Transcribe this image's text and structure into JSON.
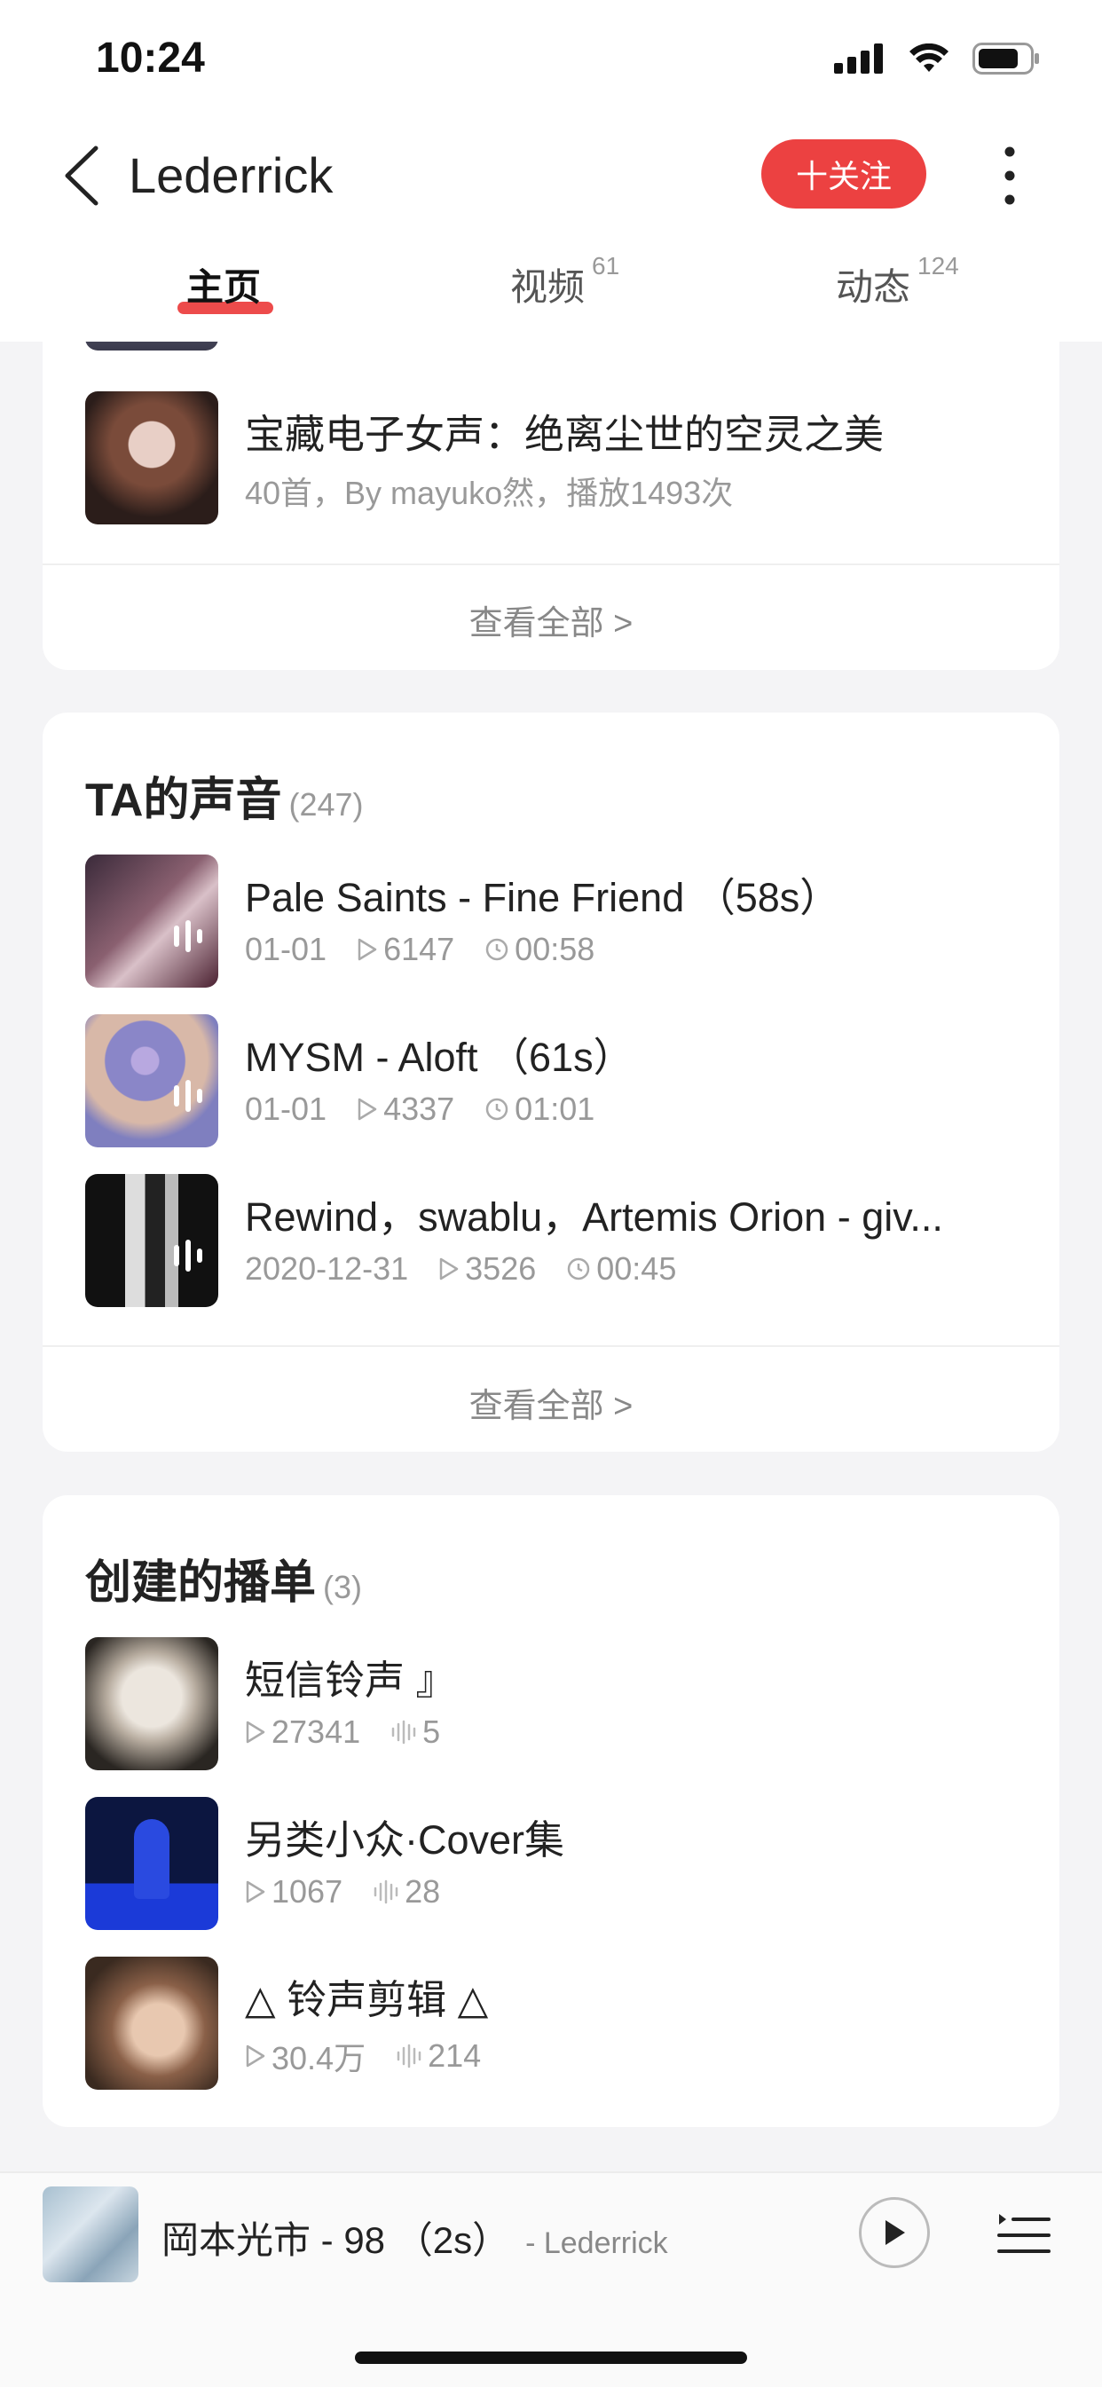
{
  "status_bar": {
    "time": "10:24"
  },
  "header": {
    "back_icon": "chevron-left-icon",
    "title": "Lederrick",
    "follow_label": "十关注",
    "more_icon": "vertical-dots-icon"
  },
  "tabs": [
    {
      "label": "主页",
      "count": ""
    },
    {
      "label": "视频",
      "count": "61"
    },
    {
      "label": "动态",
      "count": "124"
    }
  ],
  "top_card": {
    "item": {
      "title": "宝藏电子女声：绝离尘世的空灵之美",
      "meta": "40首，By mayuko然，播放1493次"
    },
    "see_all": "查看全部 >"
  },
  "sounds": {
    "title": "TA的声音",
    "count": "(247)",
    "items": [
      {
        "title": "Pale Saints - Fine Friend （58s）",
        "date": "01-01",
        "plays": "6147",
        "duration": "00:58"
      },
      {
        "title": "MYSM - Aloft （61s）",
        "date": "01-01",
        "plays": "4337",
        "duration": "01:01"
      },
      {
        "title": "Rewind，swablu，Artemis Orion - giv...",
        "date": "2020-12-31",
        "plays": "3526",
        "duration": "00:45"
      }
    ],
    "see_all": "查看全部 >"
  },
  "playlists": {
    "title": "创建的播单",
    "count": "(3)",
    "items": [
      {
        "title": "短信铃声 』",
        "plays": "27341",
        "tracks": "5"
      },
      {
        "title": "另类小众·Cover集",
        "plays": "1067",
        "tracks": "28"
      },
      {
        "title": "△ 铃声剪辑 △",
        "plays": "30.4万",
        "tracks": "214"
      }
    ]
  },
  "player": {
    "title": "岡本光市 - 98 （2s）",
    "author": "- Lederrick",
    "play_icon": "play-icon",
    "list_icon": "playlist-icon"
  },
  "colors": {
    "accent": "#ec4141",
    "background": "#f4f4f6",
    "card": "#ffffff"
  }
}
